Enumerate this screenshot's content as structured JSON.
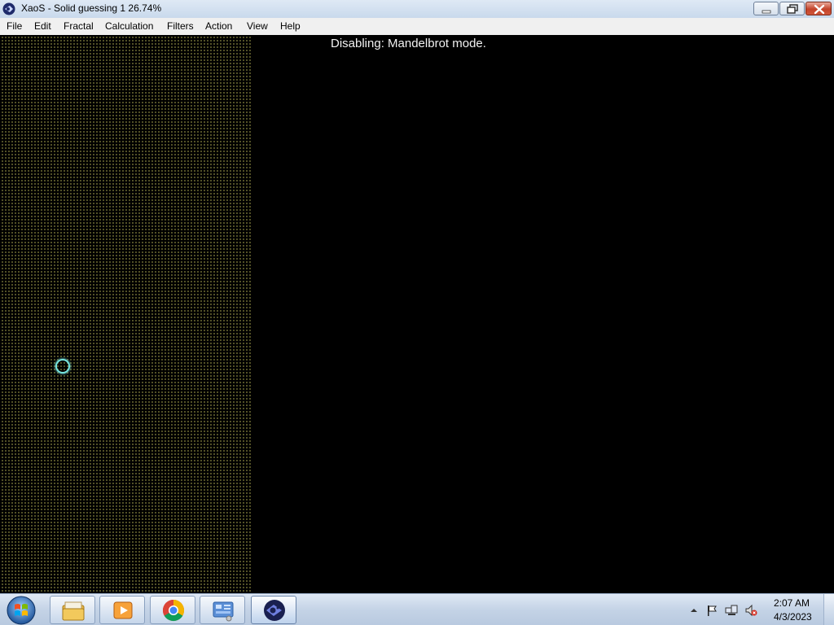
{
  "window": {
    "title": "XaoS - Solid guessing 1 26.74%",
    "app_icon": "xaos-icon",
    "controls": [
      "minimize-icon",
      "restore-icon",
      "close-icon"
    ]
  },
  "menu": {
    "items": [
      {
        "label": "File"
      },
      {
        "label": "Edit"
      },
      {
        "label": "Fractal"
      },
      {
        "label": "Calculation"
      },
      {
        "label": "Filters"
      },
      {
        "label": "Action"
      },
      {
        "label": "View"
      },
      {
        "label": "Help"
      }
    ]
  },
  "canvas": {
    "message": "Disabling: Mandelbrot mode."
  },
  "taskbar": {
    "start_icon": "windows-start-icon",
    "pinned": [
      {
        "icon": "file-explorer-icon"
      },
      {
        "icon": "media-player-icon"
      },
      {
        "icon": "chrome-icon"
      },
      {
        "icon": "control-panel-icon"
      },
      {
        "icon": "xaos-icon",
        "active": true
      }
    ],
    "tray_icons": [
      "show-hidden-icons-arrow",
      "action-center-flag-icon",
      "network-icon",
      "volume-muted-icon"
    ],
    "clock": {
      "time": "2:07 AM",
      "date": "4/3/2023"
    }
  },
  "colors": {
    "titlebar": "#dfe9f5",
    "menubar": "#f0f0f0",
    "canvas": "#000000",
    "dot_pattern": "#9c9a4a",
    "cursor_ring": "#77e6e0",
    "message_text": "#f2f2f2"
  }
}
